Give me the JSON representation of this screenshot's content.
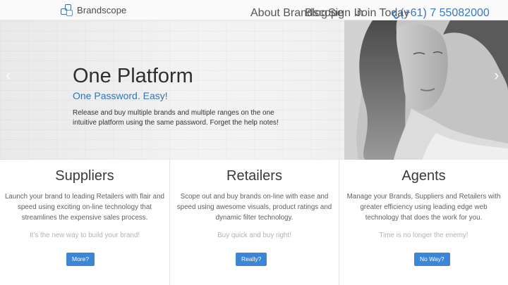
{
  "header": {
    "brand_name": "Brandscope",
    "nav": [
      {
        "label": "About Brandscope"
      },
      {
        "label": "Blog"
      },
      {
        "label": "Sign In"
      },
      {
        "label": "Join Today"
      }
    ],
    "phone": "(+61) 7 55082000",
    "phone_icon": "phone-icon",
    "accent_color": "#3a77c2"
  },
  "hero": {
    "title": "One Platform",
    "subtitle": "One Password. Easy!",
    "text": "Release and buy multiple brands and multiple ranges on the one intuitive platform using the same password. Forget the help notes!",
    "prev_icon": "chevron-left-icon",
    "next_icon": "chevron-right-icon"
  },
  "columns": [
    {
      "title": "Suppliers",
      "text": "Launch your brand to leading Retailers with flair and speed using exciting on-line technology that streamlines the expensive sales process.",
      "tagline": "It’s the new way to build your brand!",
      "button": "More?"
    },
    {
      "title": "Retailers",
      "text": "Scope out and buy brands on-line with ease and speed using awesome visuals, product ratings and dynamic filter technology.",
      "tagline": "Buy quick and buy right!",
      "button": "Really?"
    },
    {
      "title": "Agents",
      "text": "Manage your Brands, Suppliers and Retailers with greater efficiency using leading edge web technology that does the work for you.",
      "tagline": "Time is no longer the enemy!",
      "button": "No Way?"
    }
  ]
}
